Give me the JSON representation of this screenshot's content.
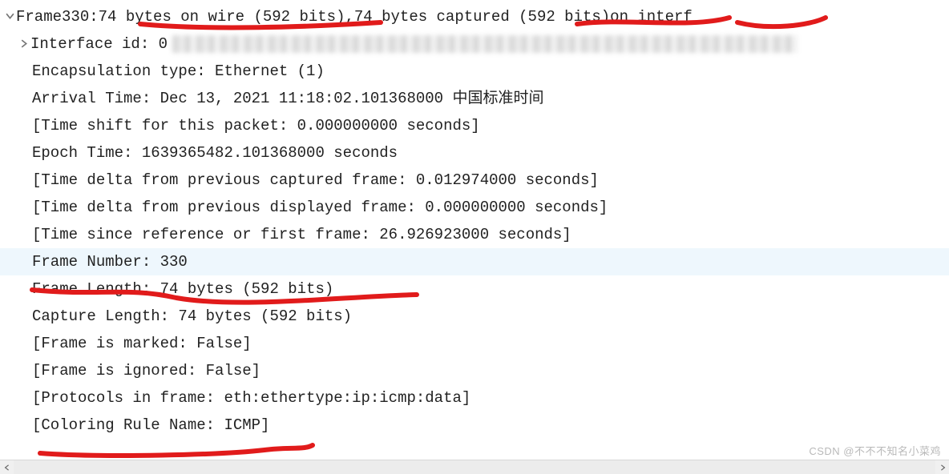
{
  "frame_header": {
    "prefix": "Frame ",
    "number": "330",
    "sep1": ": ",
    "bytes_on_wire": "74 bytes on wire (592 bits)",
    "sep2": ", ",
    "bytes_captured": "74 bytes captured (592 bits)",
    "suffix": " on interf"
  },
  "lines": {
    "interface_id_label": "Interface id: 0 ",
    "encapsulation": "Encapsulation type: Ethernet (1)",
    "arrival_time": "Arrival Time: Dec 13, 2021 11:18:02.101368000 中国标准时间",
    "time_shift": "[Time shift for this packet: 0.000000000 seconds]",
    "epoch_time": "Epoch Time: 1639365482.101368000 seconds",
    "delta_captured": "[Time delta from previous captured frame: 0.012974000 seconds]",
    "delta_displayed": "[Time delta from previous displayed frame: 0.000000000 seconds]",
    "since_reference": "[Time since reference or first frame: 26.926923000 seconds]",
    "frame_number": "Frame Number: 330",
    "frame_length": "Frame Length: 74 bytes (592 bits)",
    "capture_length": "Capture Length: 74 bytes (592 bits)",
    "is_marked": "[Frame is marked: False]",
    "is_ignored": "[Frame is ignored: False]",
    "protocols": "[Protocols in frame: eth:ethertype:ip:icmp:data]",
    "coloring_rule": "[Coloring Rule Name: ICMP]"
  },
  "watermark": "CSDN @不不不知名小菜鸡"
}
